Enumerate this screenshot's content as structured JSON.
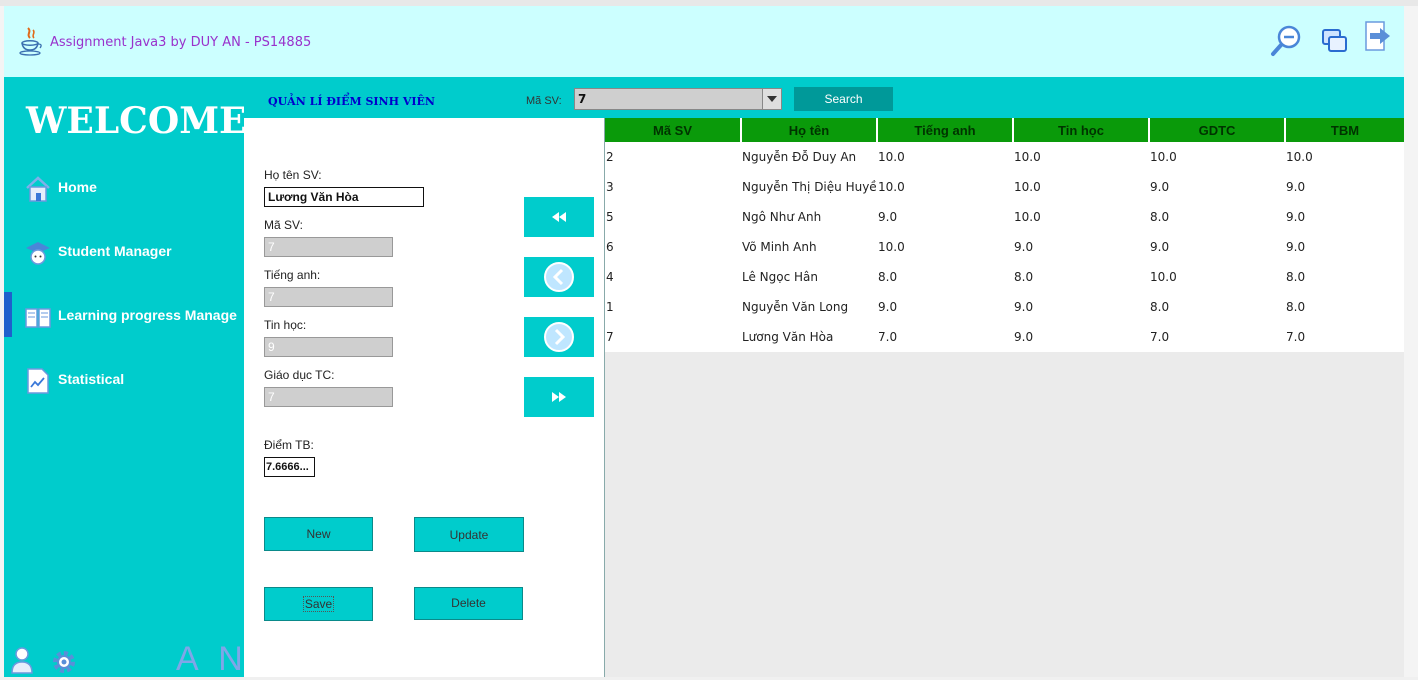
{
  "window": {
    "title": "Assignment Java3 by DUY AN - PS14885"
  },
  "header": {
    "icons": [
      "java-icon",
      "zoom-out-icon",
      "restore-window-icon",
      "exit-icon"
    ]
  },
  "sidebar": {
    "welcome": "WELCOME",
    "items": [
      {
        "label": "Home",
        "icon": "home-icon"
      },
      {
        "label": "Student Manager",
        "icon": "student-icon"
      },
      {
        "label": "Learning progress Manage",
        "icon": "book-icon",
        "active": true
      },
      {
        "label": "Statistical",
        "icon": "chart-icon"
      }
    ],
    "footer_logo": "A N",
    "accent_color": "#00cccc",
    "active_indicator_color": "#1f5fcc"
  },
  "topbar": {
    "section_title": "QUẢN LÍ ĐIỂM SINH VIÊN",
    "masv_label": "Mã SV:",
    "masv_selected": "7",
    "search_label": "Search"
  },
  "form": {
    "hoten_label": "Họ tên SV:",
    "hoten_value": "Lương Văn Hòa",
    "masv_label": "Mã SV:",
    "masv_value": "7",
    "tienganh_label": "Tiếng anh:",
    "tienganh_value": "7",
    "tinhoc_label": "Tin học:",
    "tinhoc_value": "9",
    "gdtc_label": "Giáo dục TC:",
    "gdtc_value": "7",
    "diemtb_label": "Điểm TB:",
    "diemtb_value": "7.6666...",
    "buttons": {
      "new": "New",
      "update": "Update",
      "save": "Save",
      "delete": "Delete"
    },
    "nav": [
      "first-record-icon",
      "previous-record-icon",
      "next-record-icon",
      "last-record-icon"
    ]
  },
  "table": {
    "header_color": "#0a9a0a",
    "columns": [
      "Mã SV",
      "Họ tên",
      "Tiếng anh",
      "Tin học",
      "GDTC",
      "TBM"
    ],
    "rows": [
      [
        "2",
        "Nguyễn Đỗ Duy An",
        "10.0",
        "10.0",
        "10.0",
        "10.0"
      ],
      [
        "3",
        "Nguyễn Thị Diệu Huyền",
        "10.0",
        "10.0",
        "9.0",
        "9.0"
      ],
      [
        "5",
        "Ngô Như Anh",
        "9.0",
        "10.0",
        "8.0",
        "9.0"
      ],
      [
        "6",
        "Võ Minh Anh",
        "10.0",
        "9.0",
        "9.0",
        "9.0"
      ],
      [
        "4",
        "Lê Ngọc Hân",
        "8.0",
        "8.0",
        "10.0",
        "8.0"
      ],
      [
        "1",
        "Nguyễn Văn Long",
        "9.0",
        "9.0",
        "8.0",
        "8.0"
      ],
      [
        "7",
        "Lương Văn Hòa",
        "7.0",
        "9.0",
        "7.0",
        "7.0"
      ]
    ]
  }
}
